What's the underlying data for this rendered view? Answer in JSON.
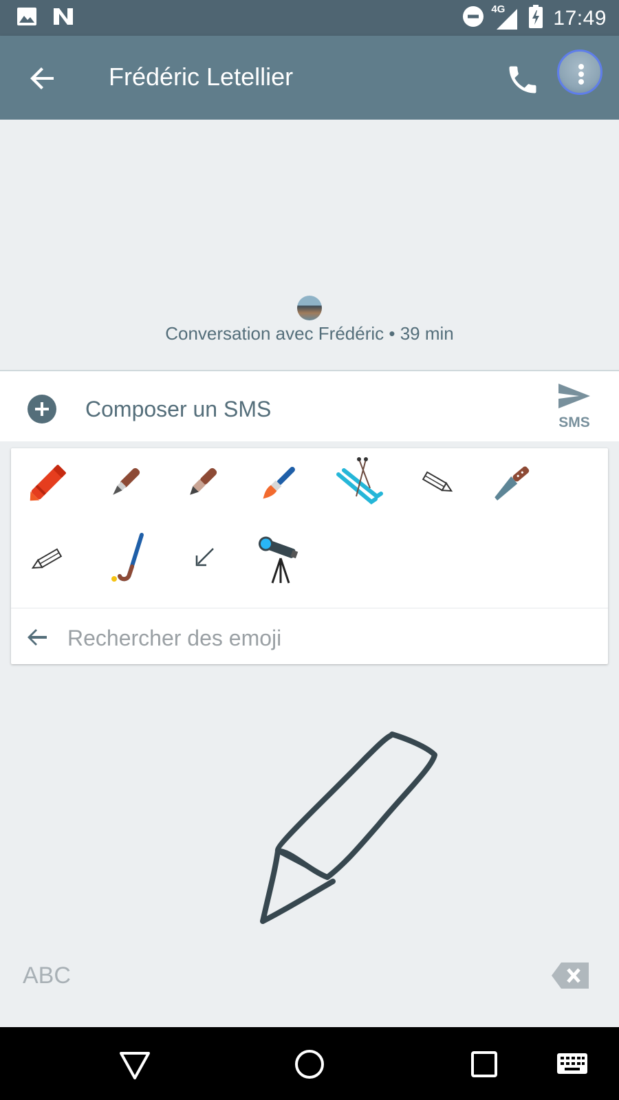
{
  "status_bar": {
    "time": "17:49",
    "network": "4G",
    "icons": [
      "image-icon",
      "n-icon",
      "do-not-disturb-icon",
      "signal-icon",
      "battery-charging-icon"
    ]
  },
  "app_bar": {
    "contact_name": "Frédéric Letellier",
    "icons": [
      "back-arrow-icon",
      "phone-icon",
      "avatar"
    ]
  },
  "conversation": {
    "info": "Conversation avec Frédéric • 39 min"
  },
  "compose": {
    "placeholder": "Composer un SMS",
    "send_label": "SMS"
  },
  "emoji_panel": {
    "emojis": [
      {
        "name": "crayon"
      },
      {
        "name": "fountain-pen"
      },
      {
        "name": "pen"
      },
      {
        "name": "paintbrush"
      },
      {
        "name": "skis"
      },
      {
        "name": "pencil"
      },
      {
        "name": "kitchen-knife"
      },
      {
        "name": "pencil"
      },
      {
        "name": "field-hockey"
      },
      {
        "name": "arrow-down-left"
      },
      {
        "name": "telescope"
      }
    ],
    "search_placeholder": "Rechercher des emoji"
  },
  "keyboard": {
    "abc_label": "ABC"
  },
  "colors": {
    "status_bar": "#4f6572",
    "app_bar": "#607d8b",
    "background": "#eceff1",
    "accent": "#546e7a",
    "handwriting_stroke": "#37474f"
  }
}
